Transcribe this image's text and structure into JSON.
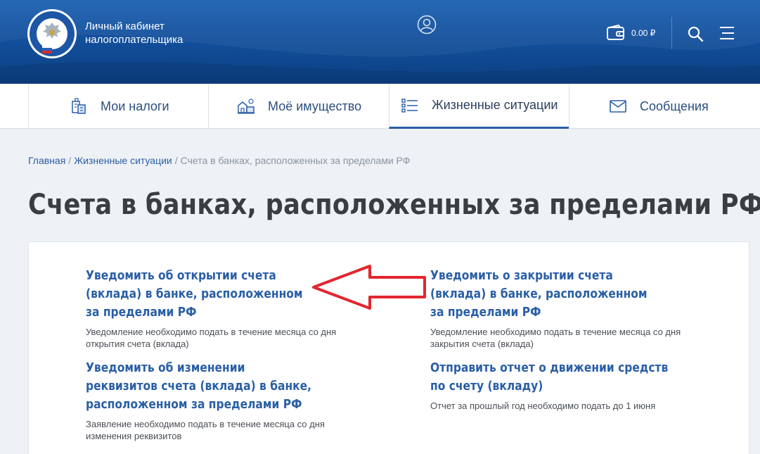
{
  "header": {
    "brand_line1": "Личный кабинет",
    "brand_line2": "налогоплательщика",
    "balance": "0.00 ₽",
    "colors": {
      "header_bg": "#114d98",
      "accent": "#2a5fa6",
      "arrow": "#e3262e"
    }
  },
  "nav": {
    "tabs": [
      {
        "label": "Мои налоги",
        "icon": "taxes-icon"
      },
      {
        "label": "Моё имущество",
        "icon": "property-icon"
      },
      {
        "label": "Жизненные ситуации",
        "icon": "list-icon",
        "active": true
      },
      {
        "label": "Сообщения",
        "icon": "envelope-icon"
      }
    ]
  },
  "breadcrumb": {
    "home": "Главная",
    "section": "Жизненные ситуации",
    "separator": "/",
    "current": "Счета в банках, расположенных за пределами РФ"
  },
  "page_title": "Счета в банках, расположенных за пределами РФ",
  "items": [
    {
      "title": "Уведомить об открытии счета (вклада) в банке, расположенном за пределами РФ",
      "desc": "Уведомление необходимо подать в течение месяца со дня открытия счета (вклада)"
    },
    {
      "title": "Уведомить о закрытии счета (вклада) в банке, расположенном за пределами РФ",
      "desc": "Уведомление необходимо подать в течение месяца со дня закрытия счета (вклада)"
    },
    {
      "title": "Уведомить об изменении реквизитов счета (вклада) в банке, расположенном за пределами РФ",
      "desc": "Заявление необходимо подать в течение месяца со дня изменения реквизитов"
    },
    {
      "title": "Отправить отчет о движении средств по счету (вкладу)",
      "desc": "Отчет за прошлый год необходимо подать до 1 июня"
    }
  ]
}
